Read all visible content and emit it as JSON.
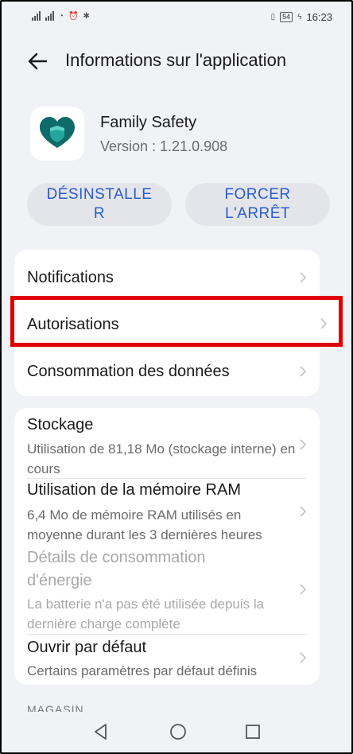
{
  "status_bar": {
    "time": "16:23",
    "battery": "54"
  },
  "header": {
    "title": "Informations sur l'application"
  },
  "app": {
    "name": "Family Safety",
    "version": "Version : 1.21.0.908"
  },
  "actions": {
    "uninstall": "DÉSINSTALLE R",
    "force_stop": "FORCER L'ARRÊT"
  },
  "card1": {
    "notifications": "Notifications",
    "permissions": "Autorisations",
    "data_usage": "Consommation des données"
  },
  "card2": {
    "storage_title": "Stockage",
    "storage_sub": "Utilisation de 81,18 Mo (stockage interne) en cours",
    "ram_title": "Utilisation de la mémoire RAM",
    "ram_sub": "6,4 Mo de mémoire RAM utilisés en moyenne durant les 3 dernières heures",
    "energy_title": "Détails de consommation d'énergie",
    "energy_sub": "La batterie n'a pas été utilisée depuis la dernière charge complète",
    "default_title": "Ouvrir par défaut",
    "default_sub": "Certains paramètres par défaut définis"
  },
  "section_store": "MAGASIN",
  "colors": {
    "accent": "#2a5cc9",
    "highlight": "#e00000",
    "icon_dark": "#0e6b69",
    "icon_light": "#23a69c"
  }
}
